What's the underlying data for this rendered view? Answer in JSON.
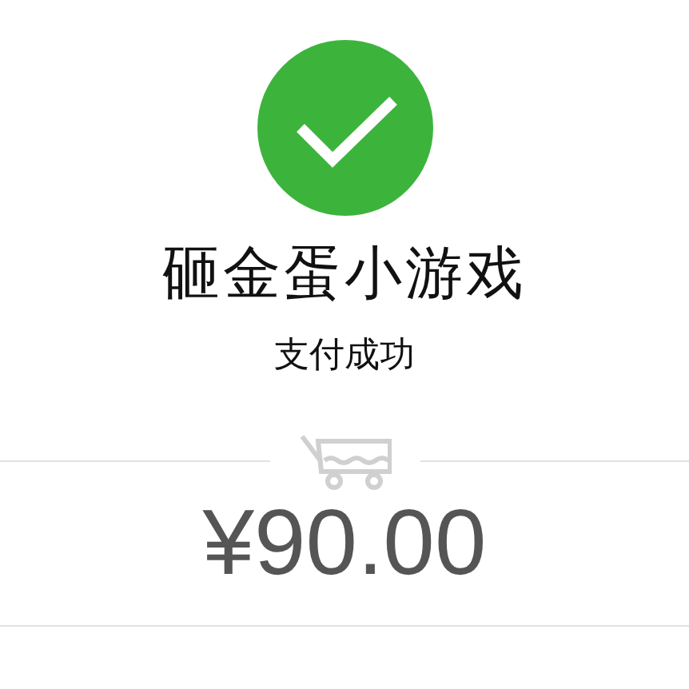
{
  "status": {
    "kind": "success"
  },
  "merchant": "砸金蛋小游戏",
  "message": "支付成功",
  "amount": "¥90.00"
}
